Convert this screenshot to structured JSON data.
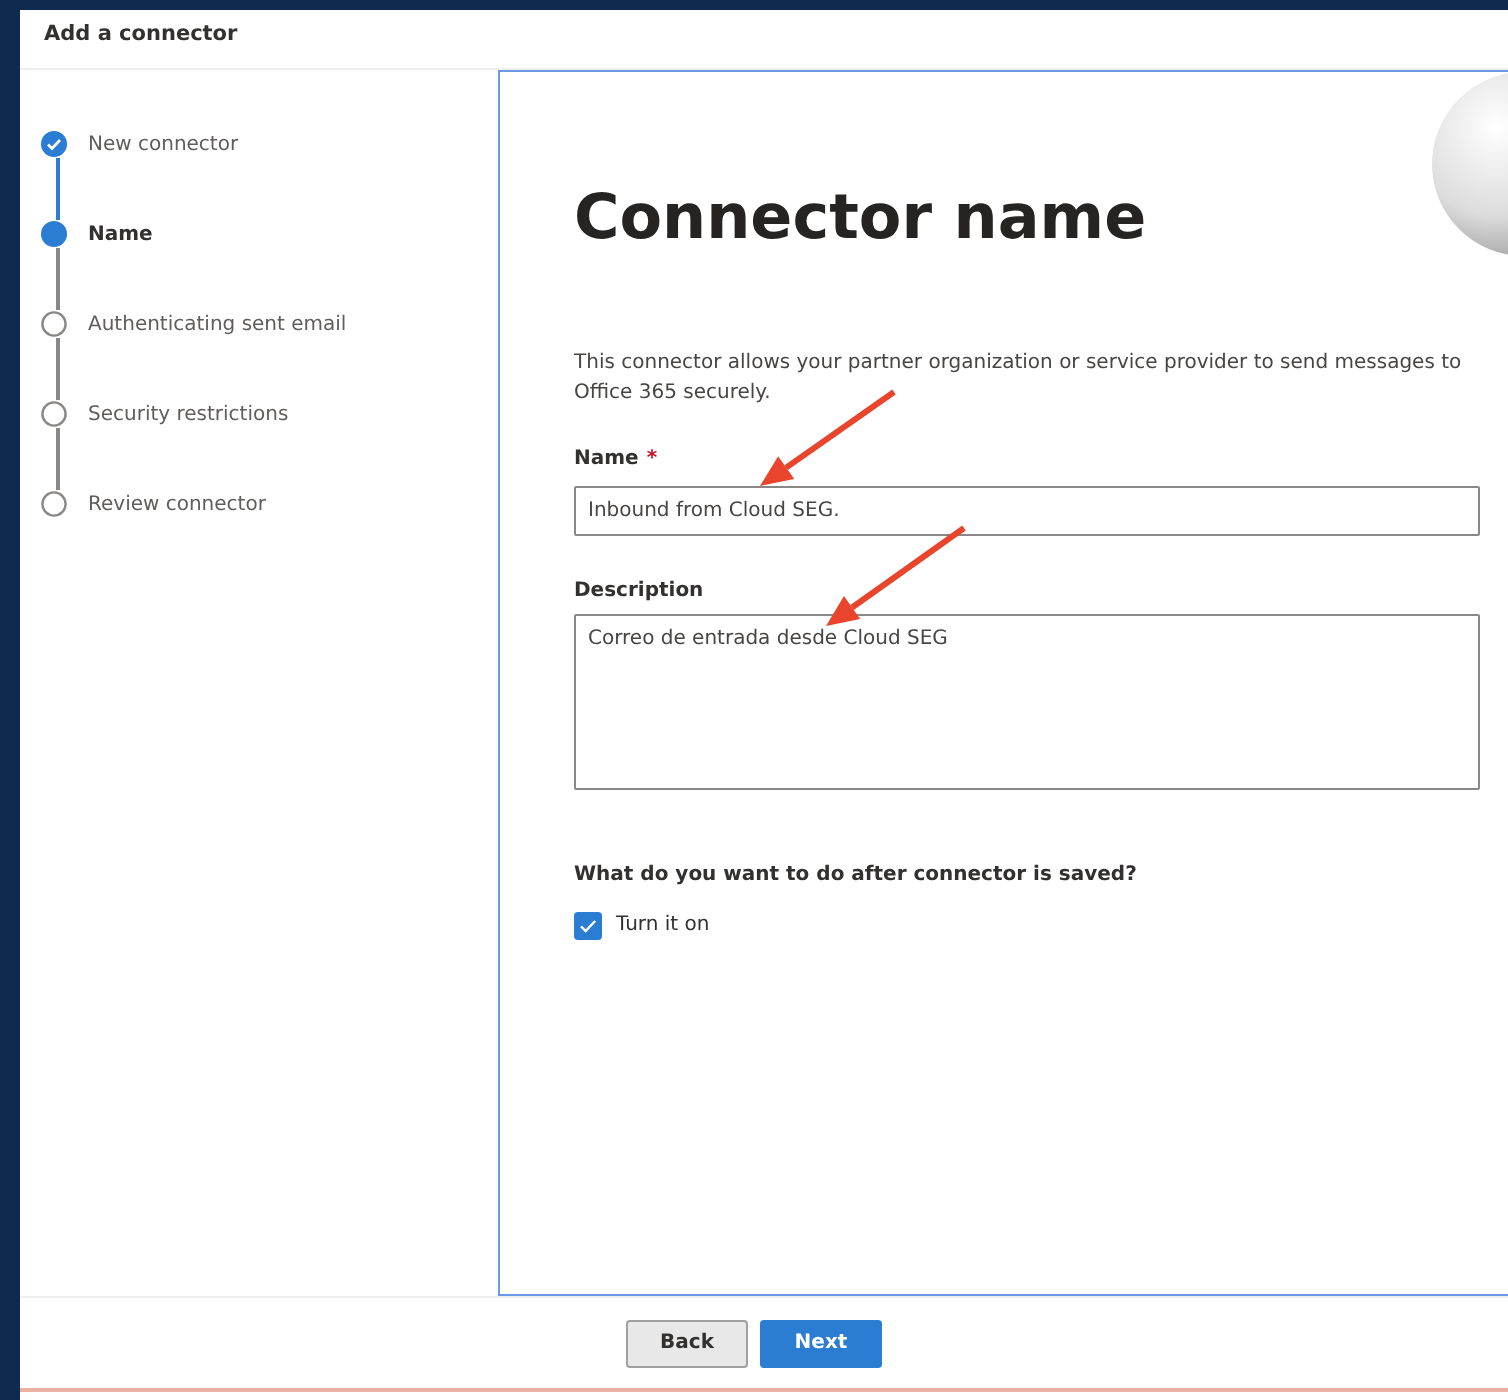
{
  "window": {
    "title": "Add a connector"
  },
  "steps": [
    {
      "label": "New connector",
      "done": true,
      "selected": false
    },
    {
      "label": "Name",
      "done": false,
      "selected": true
    },
    {
      "label": "Authenticating sent email",
      "done": false,
      "selected": false
    },
    {
      "label": "Security restrictions",
      "done": false,
      "selected": false
    },
    {
      "label": "Review connector",
      "done": false,
      "selected": false
    }
  ],
  "page": {
    "heading": "Connector name",
    "description": "This connector allows your partner organization or service provider to send messages to Office 365 securely.",
    "fields": [
      {
        "kind": "input",
        "label": "Name",
        "required_mark": "*",
        "value": "Inbound from Cloud SEG."
      },
      {
        "kind": "textarea",
        "label": "Description",
        "value": "Correo de entrada desde Cloud SEG"
      }
    ],
    "question": "What do you want to do after connector is saved?",
    "options": [
      {
        "label": "Turn it on",
        "checked": true
      }
    ]
  },
  "buttons": [
    {
      "label": "Back",
      "kind": "secondary"
    },
    {
      "label": "Next",
      "kind": "primary"
    }
  ]
}
